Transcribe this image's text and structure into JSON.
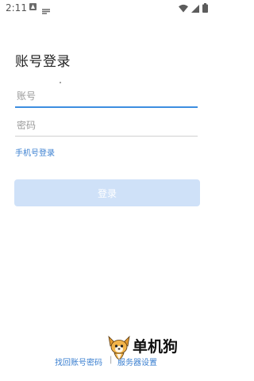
{
  "status_bar": {
    "time": "2:11",
    "icons": [
      "notification-a-icon",
      "notification-b-icon",
      "wifi-icon",
      "cellular-signal-icon",
      "battery-icon"
    ]
  },
  "login": {
    "title": "账号登录",
    "account_placeholder": "账号",
    "password_placeholder": "密码",
    "phone_login_label": "手机号登录",
    "login_button_label": "登录"
  },
  "footer": {
    "find_account_label": "找回账号密码",
    "separator": "|",
    "server_settings_label": "服务器设置"
  },
  "watermark": {
    "text": "单机狗"
  },
  "colors": {
    "accent": "#3d8ee0",
    "link": "#3a7fd0",
    "button_disabled": "#cfe1f8"
  }
}
